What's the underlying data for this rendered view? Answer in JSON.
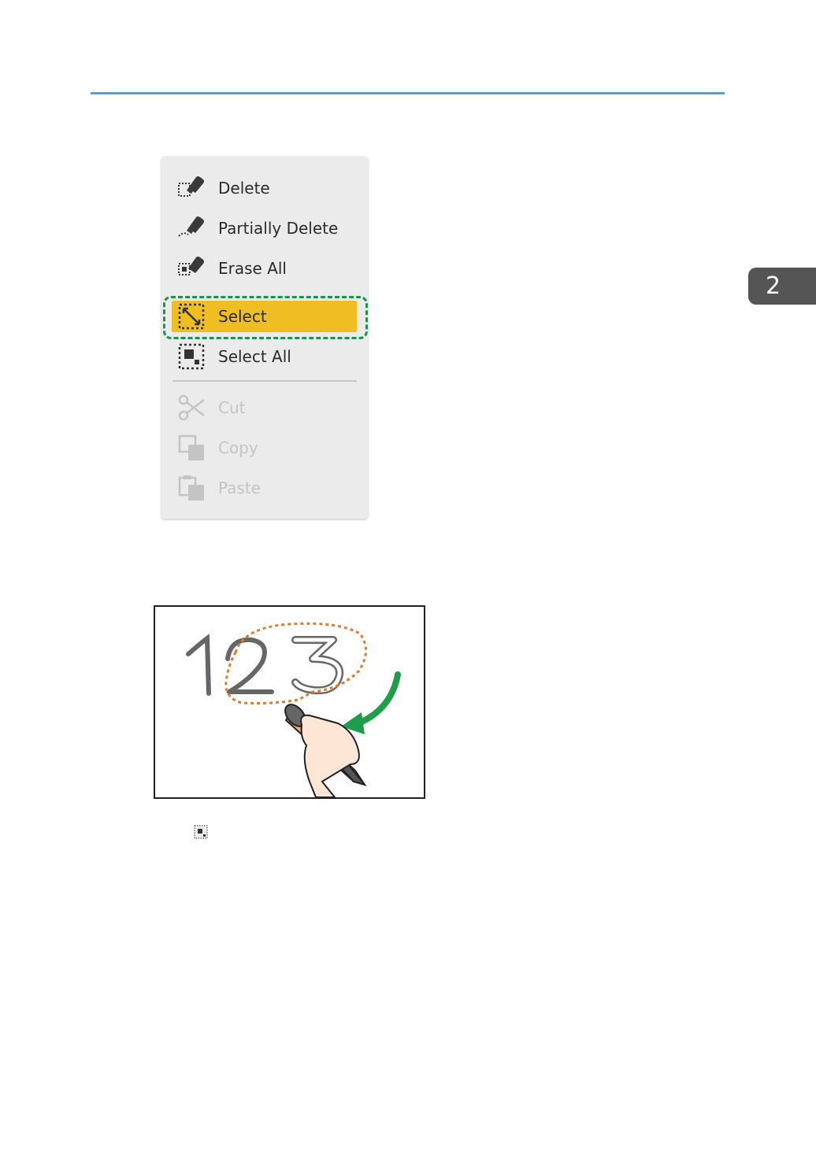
{
  "chapter_tab": {
    "number": "2"
  },
  "context_menu": {
    "items": [
      {
        "label": "Delete",
        "icon": "eraser-select-icon",
        "enabled": true
      },
      {
        "label": "Partially Delete",
        "icon": "eraser-partial-icon",
        "enabled": true
      },
      {
        "label": "Erase All",
        "icon": "eraser-all-icon",
        "enabled": true
      },
      {
        "label": "Select",
        "icon": "select-icon",
        "enabled": true,
        "highlighted": true
      },
      {
        "label": "Select All",
        "icon": "select-all-icon",
        "enabled": true
      },
      {
        "label": "Cut",
        "icon": "scissors-icon",
        "enabled": false
      },
      {
        "label": "Copy",
        "icon": "copy-icon",
        "enabled": false
      },
      {
        "label": "Paste",
        "icon": "paste-icon",
        "enabled": false
      }
    ]
  },
  "colors": {
    "highlight": "#eebe22",
    "highlight_frame": "#1e9150",
    "selection_lasso": "#e07a2c",
    "arrow": "#1e9e4a",
    "header_rule": "#4aa3d4",
    "chapter_tab": "#555555"
  },
  "illustration": {
    "digits": "123",
    "one": "1",
    "two": "2",
    "three": "3"
  },
  "inline_icon": "select-all-icon"
}
